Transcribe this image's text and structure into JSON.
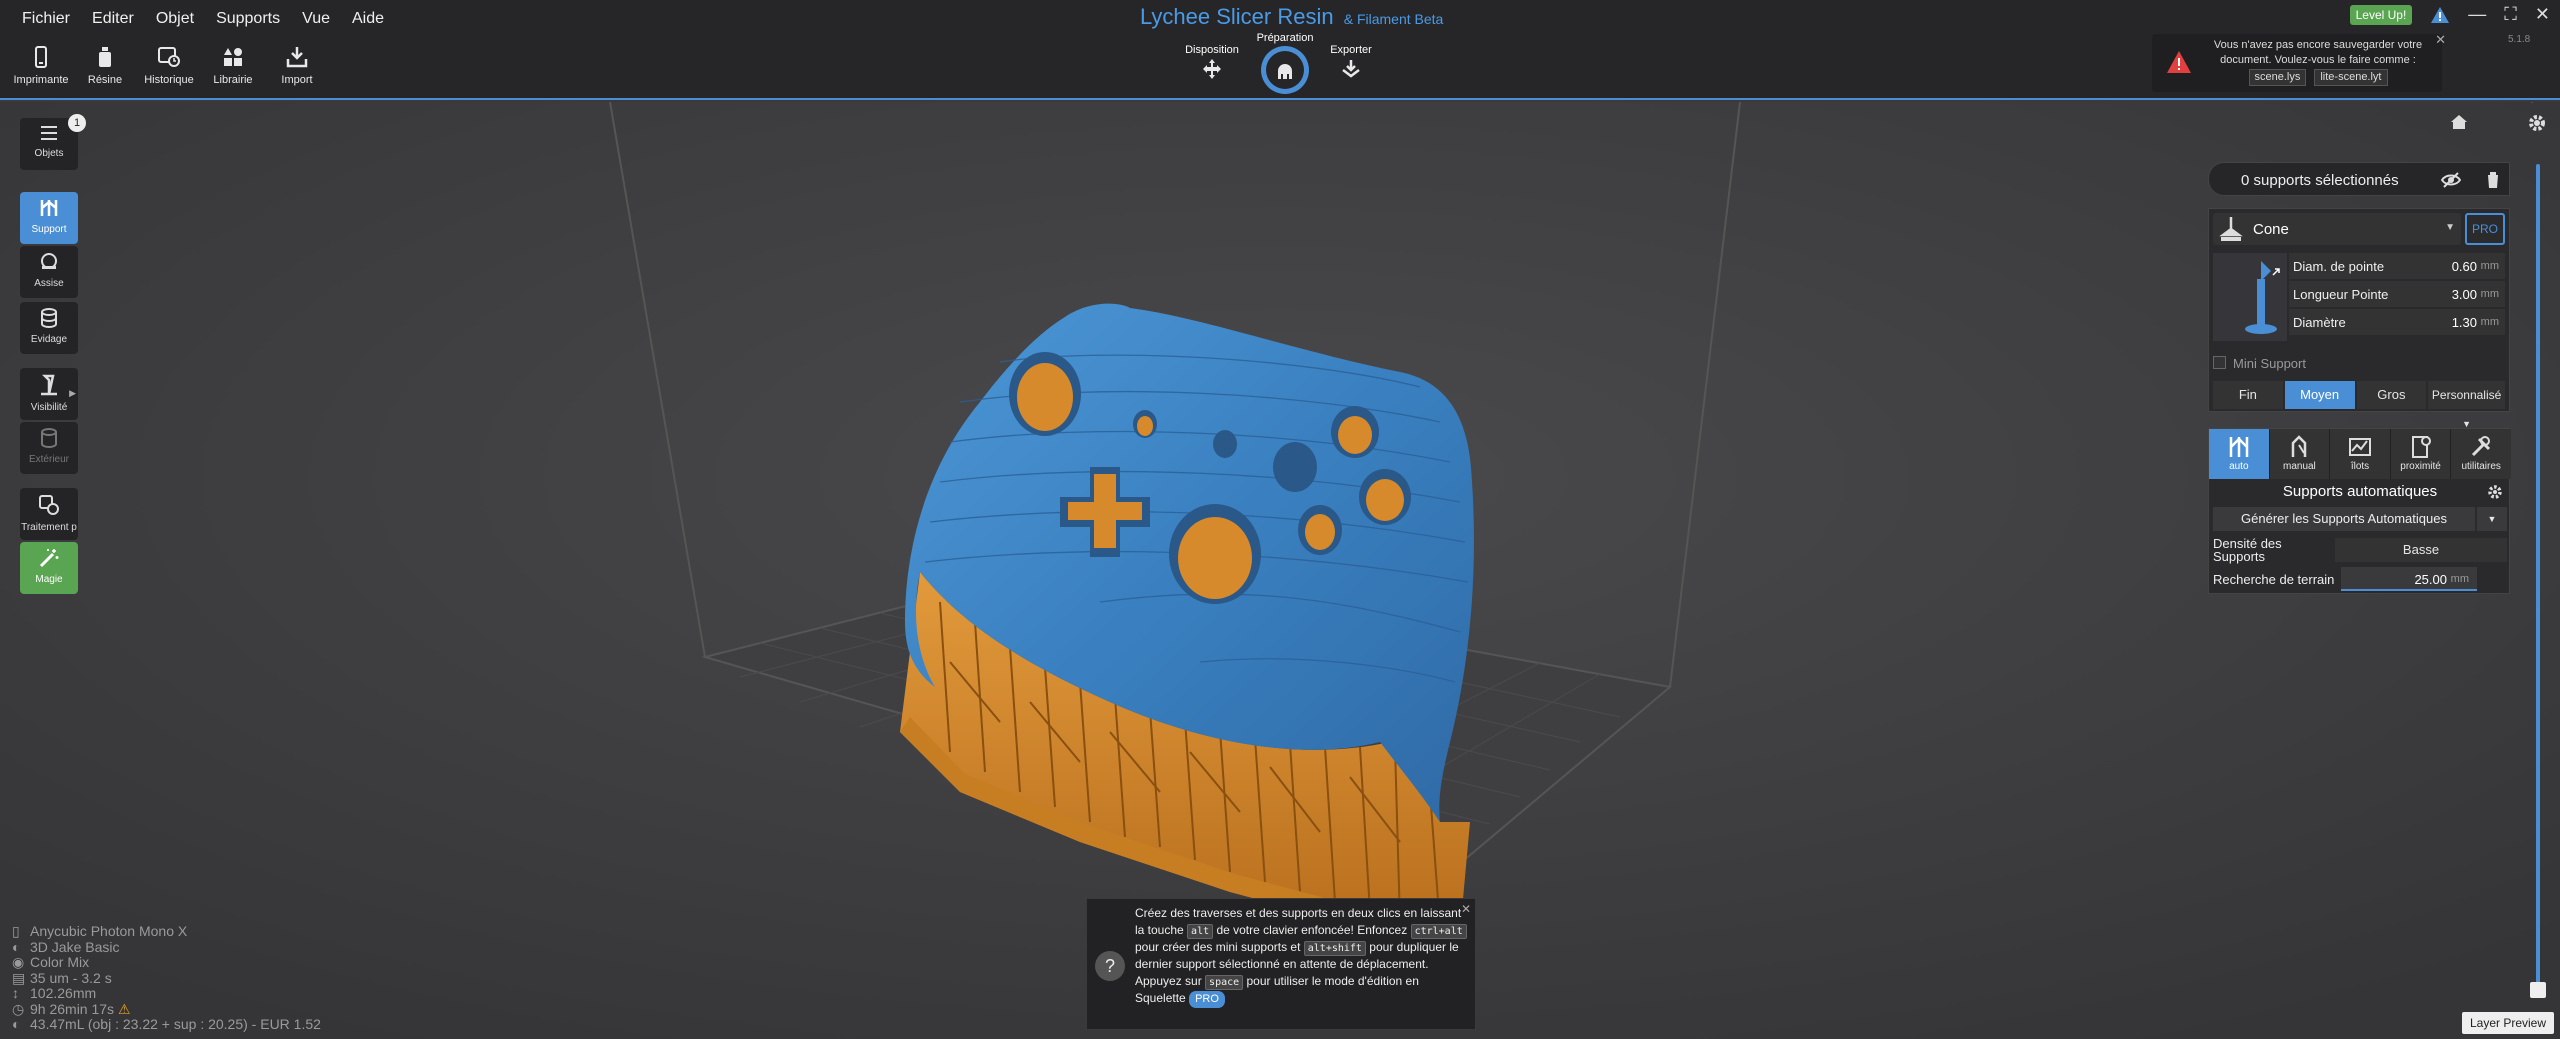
{
  "menu": [
    "Fichier",
    "Editer",
    "Objet",
    "Supports",
    "Vue",
    "Aide"
  ],
  "app": {
    "title": "Lychee Slicer Resin",
    "subtitle": "& Filament Beta",
    "version": "5.1.8"
  },
  "toolbar": [
    {
      "label": "Imprimante",
      "icon": "printer-icon"
    },
    {
      "label": "Résine",
      "icon": "resin-bottle-icon"
    },
    {
      "label": "Historique",
      "icon": "history-icon"
    },
    {
      "label": "Librairie",
      "icon": "library-icon"
    },
    {
      "label": "Import",
      "icon": "import-icon"
    }
  ],
  "modes": {
    "disposition": "Disposition",
    "preparation": "Préparation",
    "export": "Exporter"
  },
  "top_right": {
    "level_up": "Level Up!"
  },
  "notice": {
    "text": "Vous n'avez pas encore sauvegarder votre document. Voulez-vous le faire comme :",
    "opt1": "scene.lys",
    "opt2": "lite-scene.lyt"
  },
  "left_tools": [
    {
      "label": "Objets",
      "icon": "list-icon",
      "badge": "1"
    },
    {
      "label": "Support",
      "icon": "support-icon",
      "active": true
    },
    {
      "label": "Assise",
      "icon": "base-icon"
    },
    {
      "label": "Evidage",
      "icon": "hollow-icon"
    },
    {
      "label": "Visibilité",
      "icon": "visibility-icon"
    },
    {
      "label": "Extérieur",
      "icon": "exterior-icon"
    },
    {
      "label": "Traitement p",
      "icon": "processing-icon"
    },
    {
      "label": "Magie",
      "icon": "magic-wand-icon"
    }
  ],
  "supports_panel": {
    "selected": "0 supports sélectionnés",
    "type": "Cone",
    "pro": "PRO",
    "fields": [
      {
        "label": "Diam. de pointe",
        "value": "0.60",
        "unit": "mm"
      },
      {
        "label": "Longueur Pointe",
        "value": "3.00",
        "unit": "mm"
      },
      {
        "label": "Diamètre",
        "value": "1.30",
        "unit": "mm"
      }
    ],
    "mini": "Mini Support",
    "sizes": [
      "Fin",
      "Moyen",
      "Gros",
      "Personnalisé"
    ],
    "size_active": "Moyen",
    "tabs": [
      {
        "label": "auto",
        "icon": "auto-support-icon"
      },
      {
        "label": "manual",
        "icon": "manual-support-icon"
      },
      {
        "label": "îlots",
        "icon": "islands-icon"
      },
      {
        "label": "proximité",
        "icon": "proximity-icon"
      },
      {
        "label": "utilitaires",
        "icon": "tools-icon"
      }
    ],
    "auto_title": "Supports automatiques",
    "generate": "Générer les Supports Automatiques",
    "density_label": "Densité des Supports",
    "density_value": "Basse",
    "terrain_label": "Recherche de terrain",
    "terrain_value": "25.00",
    "terrain_unit": "mm"
  },
  "status": [
    "Anycubic Photon Mono X",
    "3D Jake Basic",
    "Color Mix",
    "35 um - 3.2 s",
    "102.26mm",
    "9h 26min 17s",
    "43.47mL (obj : 23.22 + sup : 20.25) - EUR 1.52"
  ],
  "tip": {
    "l1a": "Créez des traverses et des supports en deux clics en laissant la touche",
    "k1": "alt",
    "l1b": "de votre clavier enfoncée! Enfoncez",
    "k2": "ctrl+alt",
    "l2a": "pour créer des mini supports et",
    "k3": "alt+shift",
    "l2b": "pour dupliquer le dernier support sélectionné en attente de déplacement.",
    "l3a": "Appuyez sur",
    "k4": "space",
    "l3b": "pour utiliser le mode d'édition en Squelette",
    "pro": "PRO"
  },
  "layer_preview": "Layer Preview",
  "colors": {
    "accent": "#4a8fd6",
    "model": "#3d86c6",
    "supports": "#d68a2c",
    "magic": "#5aa552"
  }
}
